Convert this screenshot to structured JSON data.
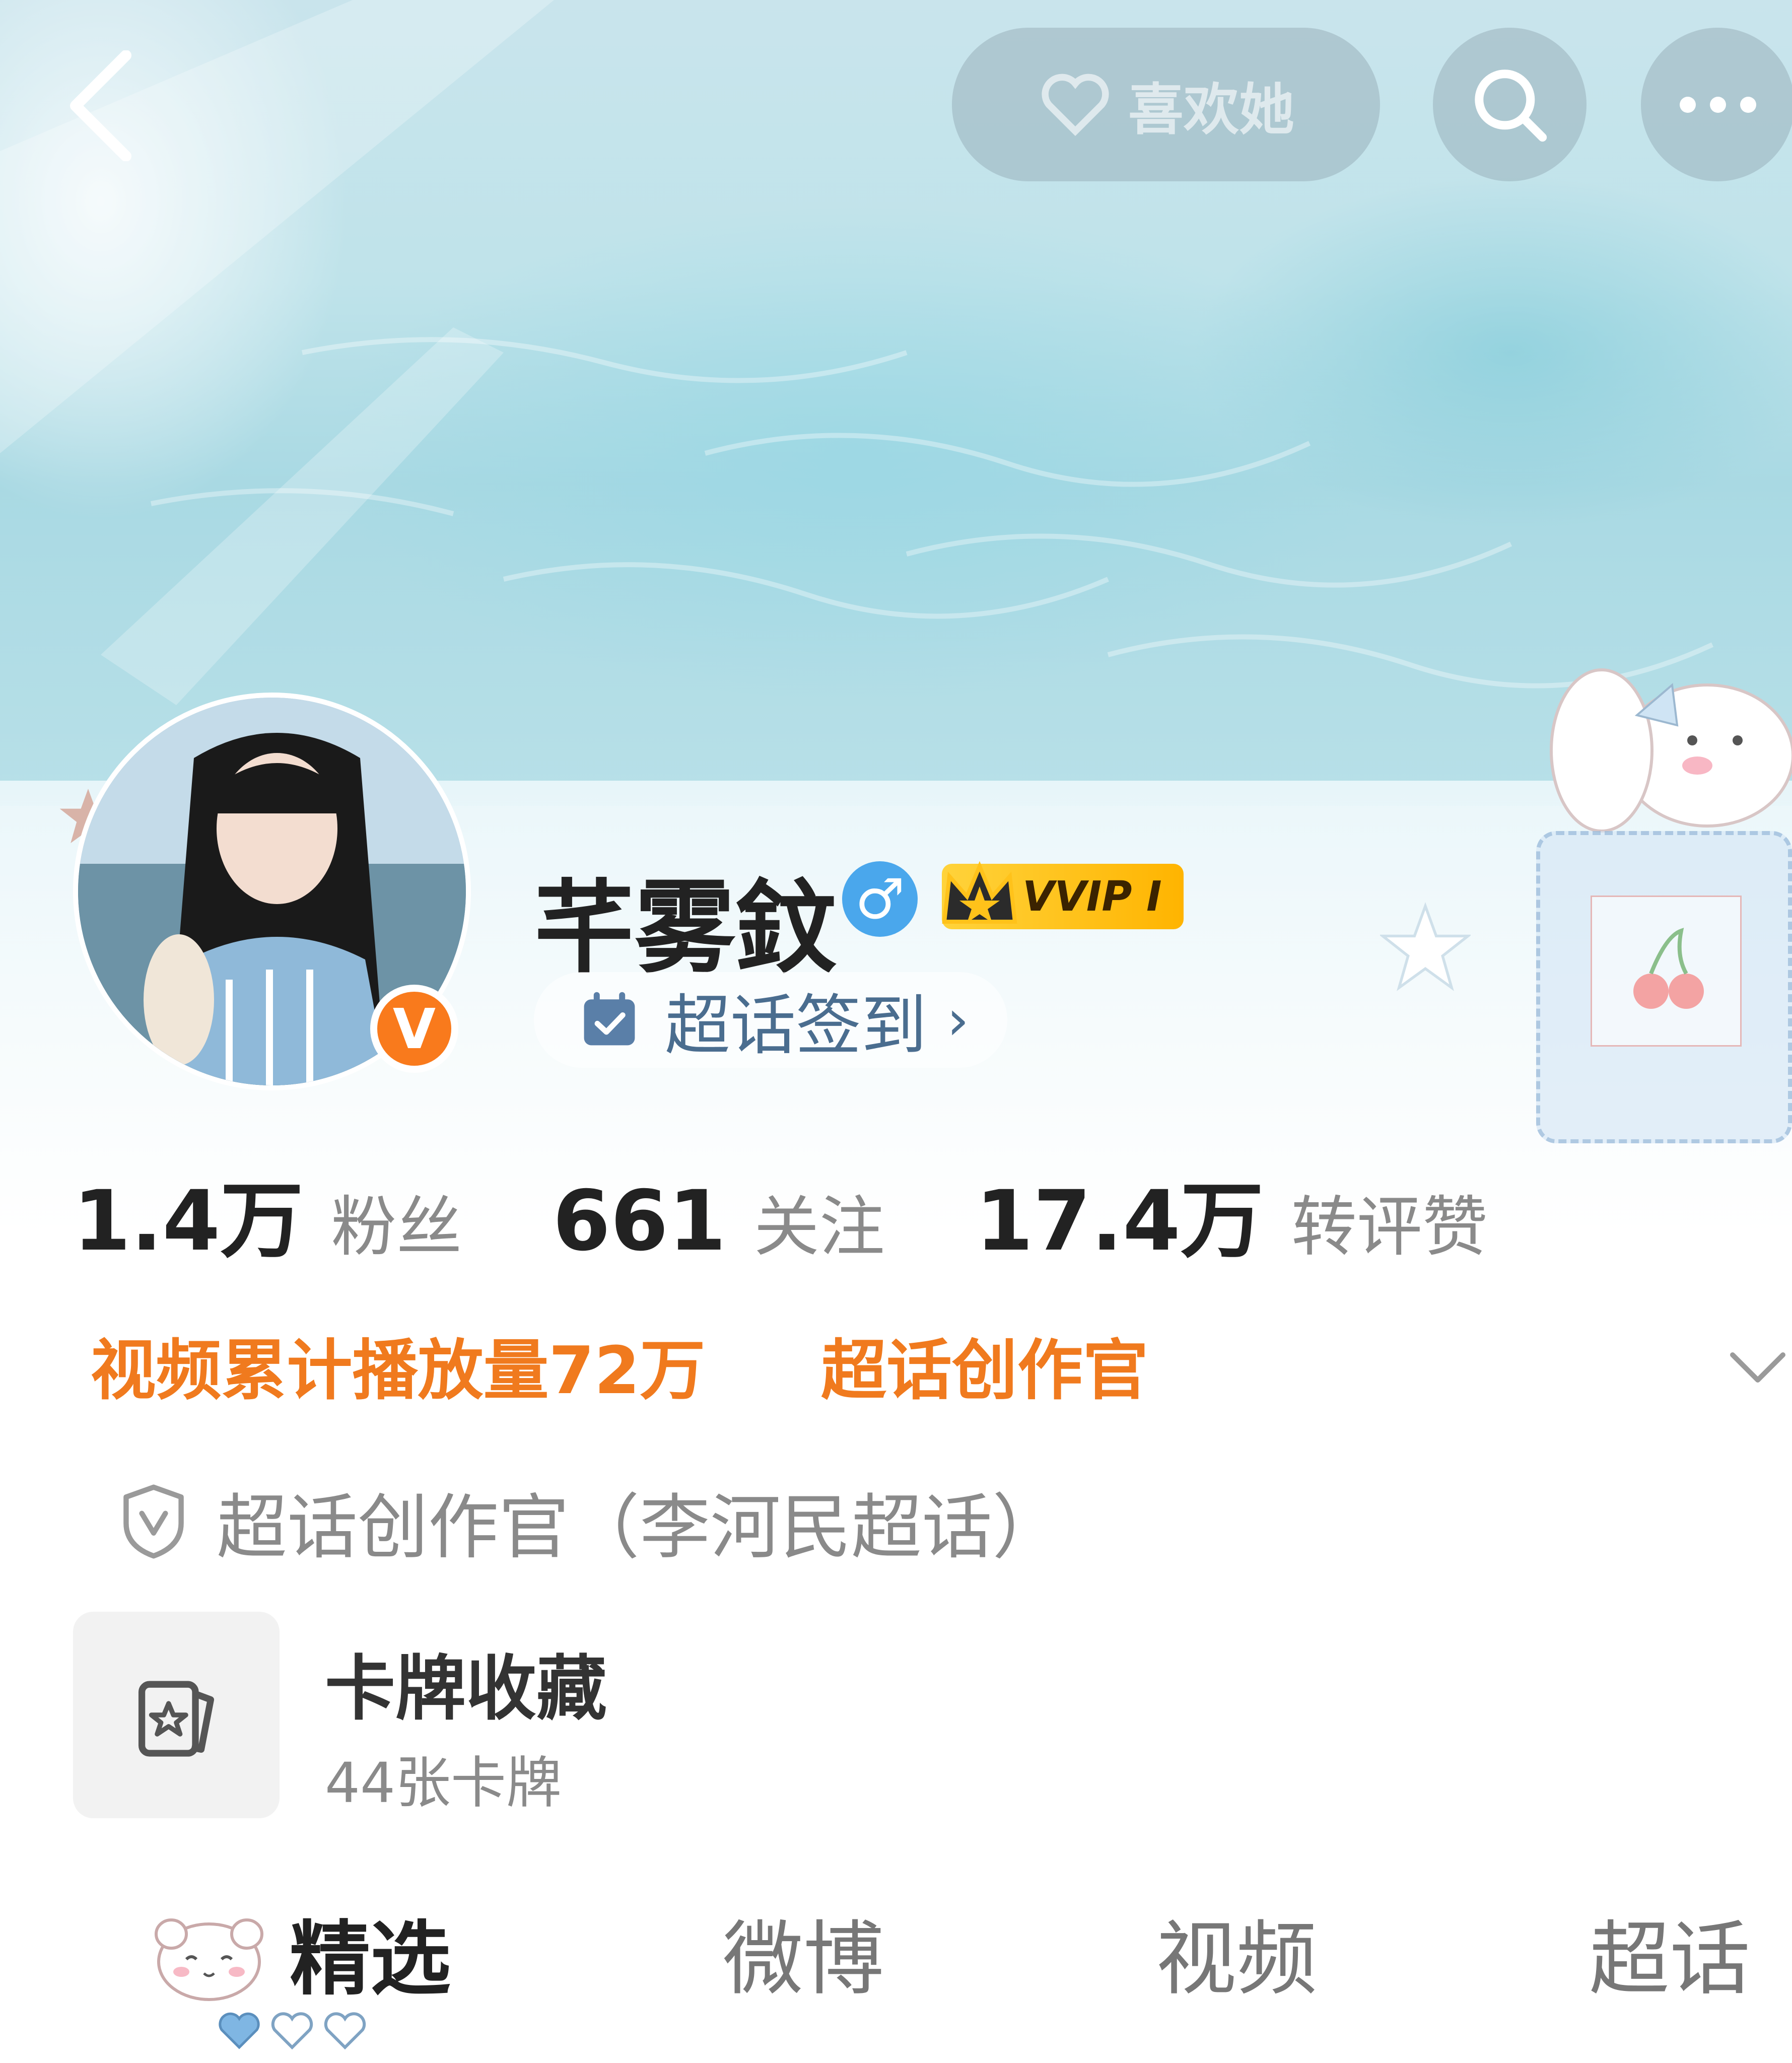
{
  "topbar": {
    "like_label": "喜欢她"
  },
  "profile": {
    "name": "芊雾鈫",
    "verified_badge": "V",
    "gender_symbol": "♂",
    "vip_label": "VVIP Ⅰ",
    "checkin_label": "超话签到",
    "checkin_chevron": "›"
  },
  "stats": [
    {
      "value": "1.4万",
      "label": "粉丝"
    },
    {
      "value": "661",
      "label": "关注"
    },
    {
      "value": "17.4万",
      "label": "转评赞"
    }
  ],
  "tags": {
    "video_plays": "视频累计播放量72万",
    "creator": "超话创作官"
  },
  "certification": "超话创作官（李河民超话）",
  "card_collection": {
    "title": "卡牌收藏",
    "subtitle": "44张卡牌"
  },
  "tabs": [
    "精选",
    "微博",
    "视频",
    "超话"
  ],
  "colors": {
    "accent_orange": "#f07a1e",
    "gender_blue": "#4aa7ec",
    "vip_gold": "#ffc21a"
  },
  "icons": [
    "back-arrow-icon",
    "heart-icon",
    "search-icon",
    "more-icon",
    "calendar-check-icon",
    "shield-v-icon",
    "card-star-icon",
    "chevron-down-icon"
  ]
}
